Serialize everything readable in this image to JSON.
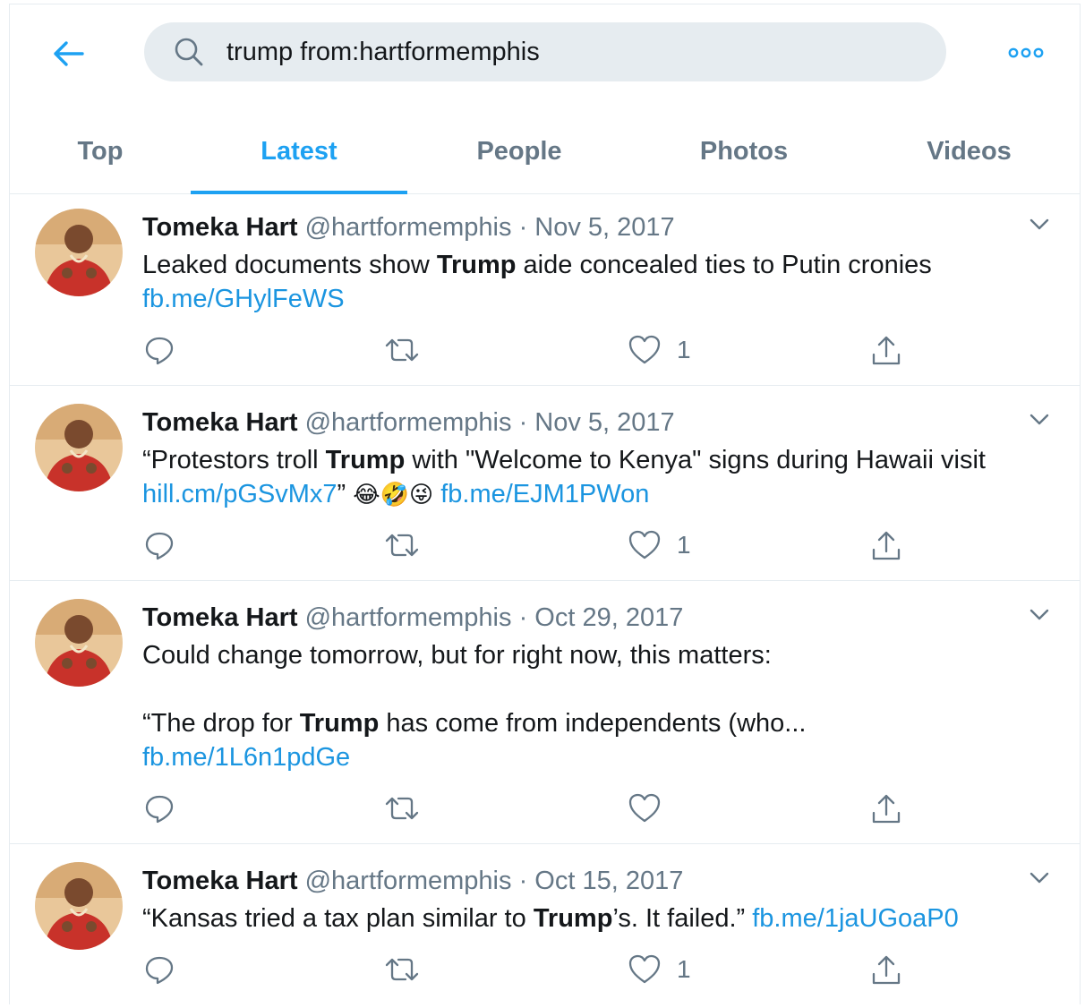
{
  "search": {
    "query": "trump from:hartformemphis"
  },
  "tabs": [
    {
      "label": "Top",
      "active": false
    },
    {
      "label": "Latest",
      "active": true
    },
    {
      "label": "People",
      "active": false
    },
    {
      "label": "Photos",
      "active": false
    },
    {
      "label": "Videos",
      "active": false
    }
  ],
  "tweets": [
    {
      "name": "Tomeka Hart",
      "handle": "@hartformemphis",
      "sep": "·",
      "date": "Nov 5, 2017",
      "text": {
        "pre": "Leaked documents show ",
        "bold": "Trump",
        "post": " aide concealed ties to Putin cronies",
        "link": "fb.me/GHylFeWS"
      },
      "likes": "1"
    },
    {
      "name": "Tomeka Hart",
      "handle": "@hartformemphis",
      "sep": "·",
      "date": "Nov 5, 2017",
      "text": {
        "pre": "“Protestors troll ",
        "bold": "Trump",
        "post": " with \"Welcome to Kenya\" signs during Hawaii visit",
        "link1": "hill.cm/pGSvMx7",
        "quote_close": "”",
        "emojis": "😂🤣😜",
        "link2": "fb.me/EJM1PWon"
      },
      "likes": "1"
    },
    {
      "name": "Tomeka Hart",
      "handle": "@hartformemphis",
      "sep": "·",
      "date": "Oct 29, 2017",
      "text": {
        "line1": "Could change tomorrow, but for right now, this matters:",
        "pre": "“The drop for ",
        "bold": "Trump",
        "post": " has come from independents (who...",
        "link": "fb.me/1L6n1pdGe"
      },
      "likes": ""
    },
    {
      "name": "Tomeka Hart",
      "handle": "@hartformemphis",
      "sep": "·",
      "date": "Oct 15, 2017",
      "text": {
        "pre": "“Kansas tried a tax plan similar to ",
        "bold": "Trump",
        "post": "’s. It failed.” ",
        "link": "fb.me/1jaUGoaP0"
      },
      "likes": "1"
    }
  ],
  "colors": {
    "accent": "#1da1f2",
    "link": "#1b95e0",
    "muted": "#657786",
    "avatar_dress": "#c8322a"
  },
  "icons": [
    "back-arrow-icon",
    "search-icon",
    "more-icon",
    "chevron-down-icon",
    "reply-icon",
    "retweet-icon",
    "like-icon",
    "share-icon"
  ]
}
